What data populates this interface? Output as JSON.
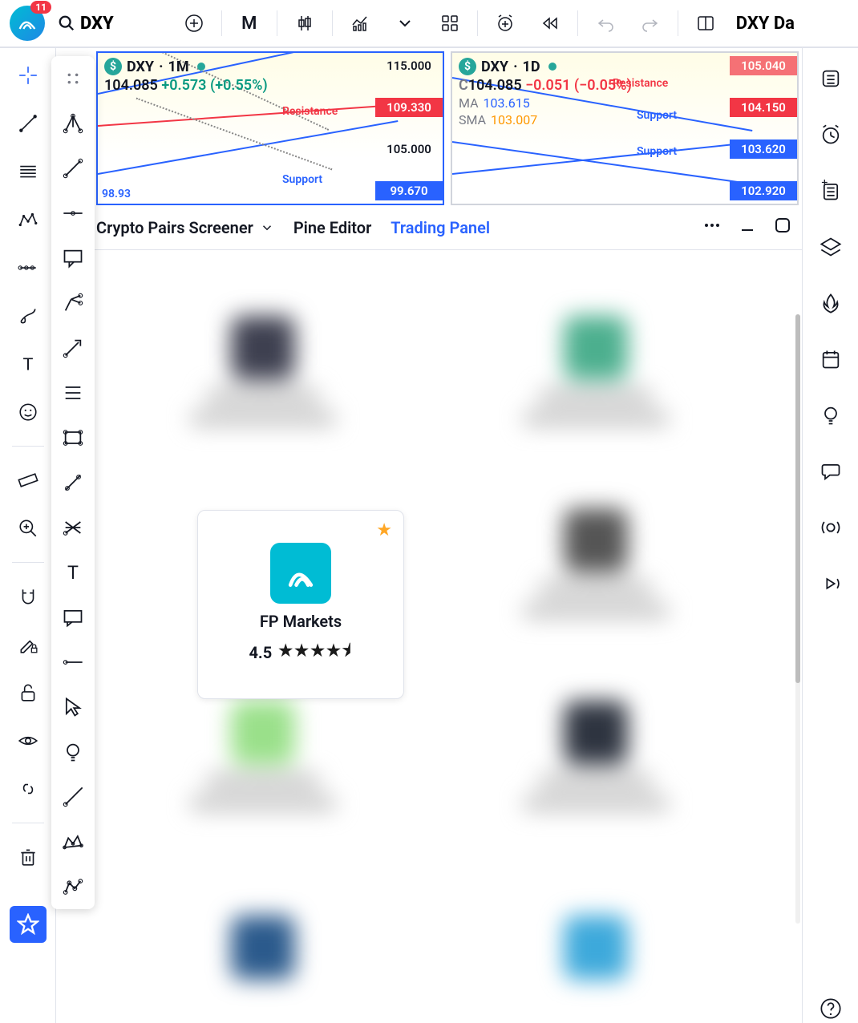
{
  "header": {
    "notifications": "11",
    "symbol": "DXY",
    "interval": "M",
    "right_text": "DXY Da"
  },
  "charts": [
    {
      "symbol": "DXY",
      "timeframe": "1M",
      "close": "104.085",
      "change": "+0.573",
      "change_pct": "(+0.55%)",
      "direction": "pos",
      "annotations": {
        "resistance": "Resistance",
        "support": "Support"
      },
      "prices": [
        {
          "value": "115.000",
          "class": ""
        },
        {
          "value": "109.330",
          "class": "red"
        },
        {
          "value": "105.000",
          "class": ""
        },
        {
          "value": "99.670",
          "class": "blue"
        }
      ],
      "bottom_value": "98.93"
    },
    {
      "symbol": "DXY",
      "timeframe": "1D",
      "close_prefix": "C",
      "close": "104.085",
      "change": "−0.051",
      "change_pct": "(−0.05%)",
      "direction": "neg",
      "indicators": [
        {
          "label": "MA",
          "value": "103.615"
        },
        {
          "label": "SMA",
          "value": "103.007"
        }
      ],
      "annotations": {
        "resistance": "Resistance",
        "support1": "Support",
        "support2": "Support"
      },
      "prices": [
        {
          "value": "105.040",
          "class": "red"
        },
        {
          "value": "104.150",
          "class": "red"
        },
        {
          "value": "103.620",
          "class": "blue"
        },
        {
          "value": "102.920",
          "class": "blue"
        }
      ]
    }
  ],
  "panel_tabs": {
    "screener": "Crypto Pairs Screener",
    "pine": "Pine Editor",
    "trading": "Trading Panel"
  },
  "broker": {
    "name": "FP Markets",
    "rating": "4.5",
    "stars": "★★★★⯨"
  }
}
